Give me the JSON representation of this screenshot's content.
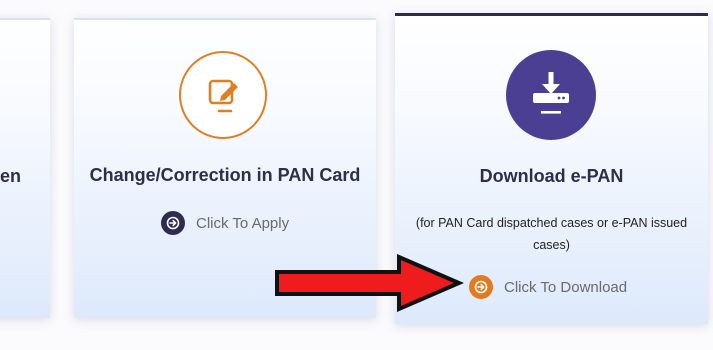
{
  "left_card": {
    "partial_title": "en"
  },
  "correction_card": {
    "icon": "edit-icon",
    "title": "Change/Correction in PAN Card",
    "action_label": "Click To Apply",
    "action_icon": "arrow-circle-icon"
  },
  "download_card": {
    "icon": "download-icon",
    "title": "Download e-PAN",
    "note": "(for PAN Card dispatched cases or e-PAN issued cases)",
    "action_label": "Click To Download",
    "action_icon": "arrow-circle-icon"
  },
  "annotation": {
    "type": "red-arrow-icon",
    "color": "#ee1c1c"
  },
  "colors": {
    "accent_orange": "#e07f21",
    "accent_purple": "#4a3f93",
    "title_text": "#2c2e4a",
    "action_text": "#6a6a6a"
  }
}
